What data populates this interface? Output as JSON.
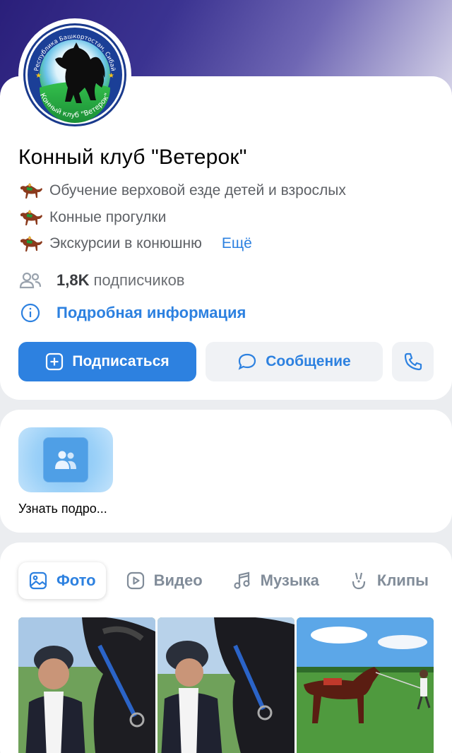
{
  "cover": {
    "gradient_start": "#2a1f7a",
    "gradient_end": "#d9d7ea"
  },
  "logo": {
    "top_text": "Республика Башкортостан, Сибай",
    "bottom_text": "Конный клуб \"Ветерок\""
  },
  "community": {
    "title": "Конный клуб \"Ветерок\"",
    "description_lines": [
      "Обучение верховой езде детей и взрослых",
      "Конные прогулки",
      "Экскурсии в конюшню"
    ],
    "more_label": "Ещё",
    "subscribers_count": "1,8K",
    "subscribers_label": "подписчиков",
    "details_label": "Подробная информация"
  },
  "actions": {
    "subscribe_label": "Подписаться",
    "message_label": "Сообщение",
    "call_icon": "phone-icon"
  },
  "widget": {
    "label": "Узнать подро..."
  },
  "media_tabs": [
    {
      "label": "Фото",
      "icon": "image-icon",
      "active": true
    },
    {
      "label": "Видео",
      "icon": "video-icon",
      "active": false
    },
    {
      "label": "Музыка",
      "icon": "music-note-icon",
      "active": false
    },
    {
      "label": "Клипы",
      "icon": "clips-icon",
      "active": false
    }
  ],
  "photos": [
    "photo-rider-with-horse",
    "photo-rider-with-horse-2",
    "photo-horse-in-field"
  ],
  "colors": {
    "accent": "#2d81e0",
    "secondary_text": "#5e6166",
    "tab_inactive": "#818c99",
    "page_background": "#ebedf0"
  }
}
